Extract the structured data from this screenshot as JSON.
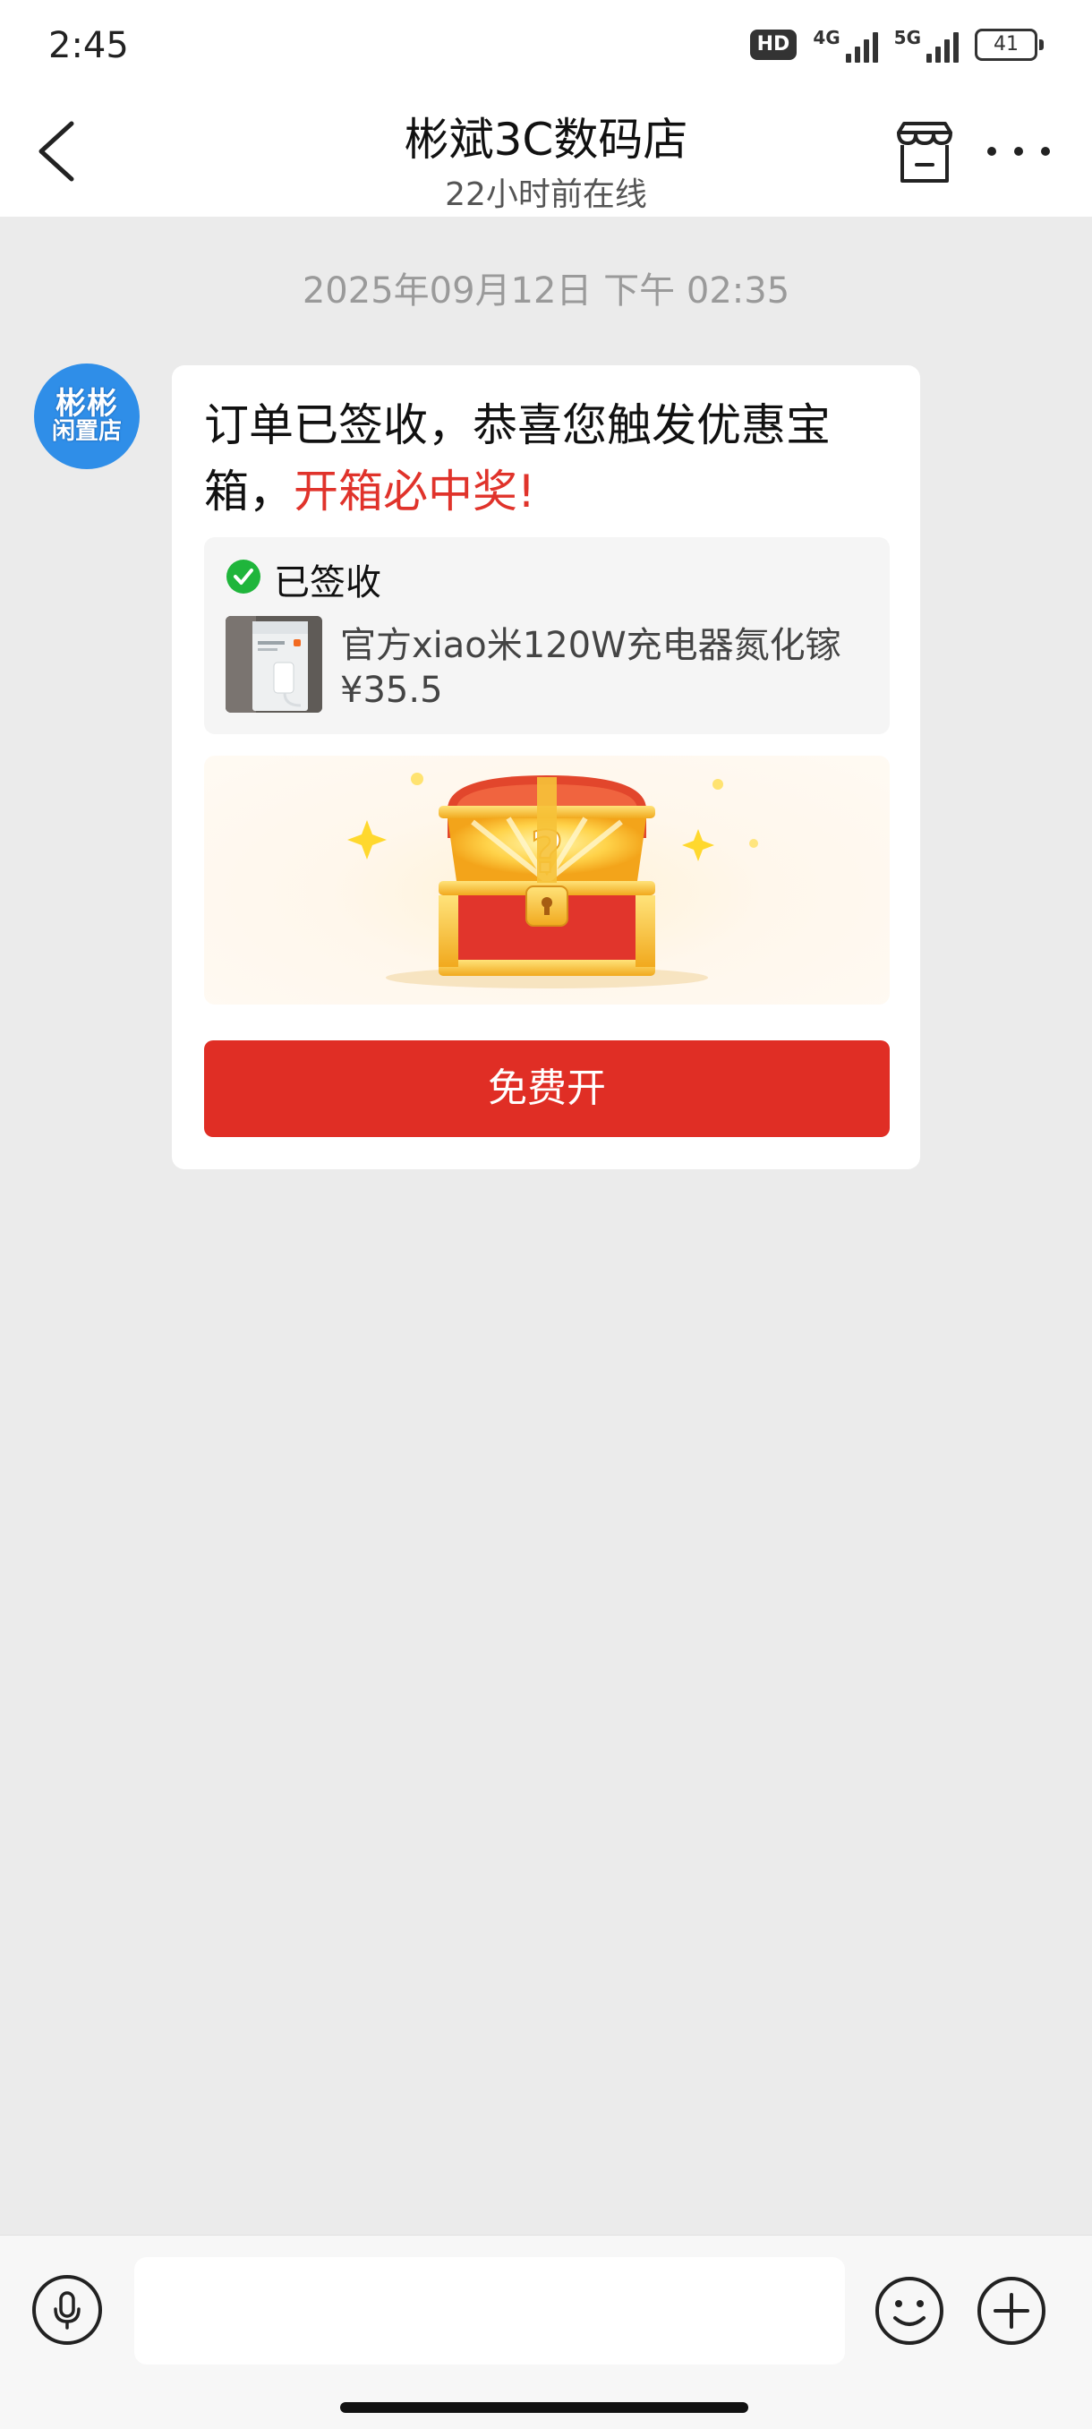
{
  "status_bar": {
    "time": "2:45",
    "hd_badge": "HD",
    "network_1": "4G",
    "network_2": "5G",
    "battery": "41"
  },
  "header": {
    "title": "彬斌3C数码店",
    "subtitle": "22小时前在线"
  },
  "chat": {
    "timestamp": "2025年09月12日 下午 02:35",
    "avatar_text_line1": "彬彬",
    "avatar_text_line2": "闲置店",
    "message_black": "订单已签收，恭喜您触发优惠宝箱，",
    "message_red": "开箱必中奖!",
    "order": {
      "status": "已签收",
      "product_name": "官方xiao米120W充电器氮化镓",
      "price": "¥35.5"
    },
    "button_label": "免费开"
  },
  "input": {
    "placeholder": ""
  },
  "colors": {
    "accent_red": "#e02e25",
    "check_green": "#1fb53b",
    "avatar_blue": "#2f8ee8"
  },
  "icons": [
    "back-icon",
    "store-icon",
    "more-icon",
    "check-icon",
    "treasure-chest-icon",
    "mic-icon",
    "emoji-icon",
    "plus-icon"
  ]
}
